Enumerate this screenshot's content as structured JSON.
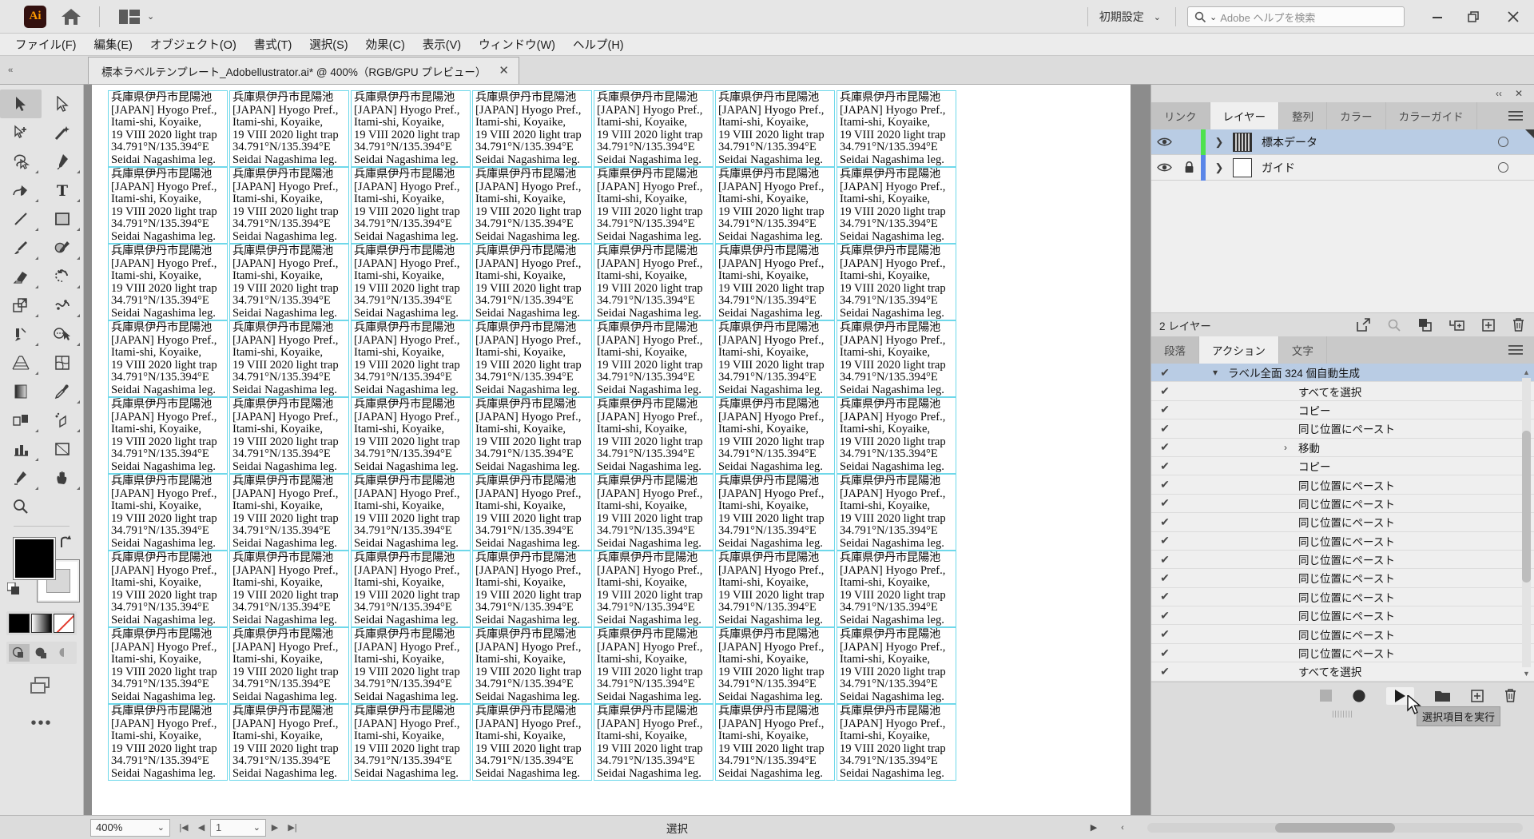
{
  "app": {
    "logo_text": "Ai",
    "preset_label": "初期設定",
    "search_placeholder": "Adobe ヘルプを検索"
  },
  "menubar": {
    "items": [
      {
        "label": "ファイル(F)"
      },
      {
        "label": "編集(E)"
      },
      {
        "label": "オブジェクト(O)"
      },
      {
        "label": "書式(T)"
      },
      {
        "label": "選択(S)"
      },
      {
        "label": "効果(C)"
      },
      {
        "label": "表示(V)"
      },
      {
        "label": "ウィンドウ(W)"
      },
      {
        "label": "ヘルプ(H)"
      }
    ]
  },
  "tabbar": {
    "doc_title": "標本ラベルテンプレート_Adobellustrator.ai* @ 400%（RGB/GPU プレビュー）",
    "close": "✕",
    "collapse": "‹‹"
  },
  "canvas": {
    "label": {
      "line1": "兵庫県伊丹市昆陽池",
      "line2": "[JAPAN] Hyogo Pref.,",
      "line3": "Itami-shi, Koyaike,",
      "line4": "19 VIII 2020 light trap",
      "line5": "34.791°N/135.394°E",
      "line6": "Seidai Nagashima leg."
    },
    "columns": 7,
    "rows": 9
  },
  "dock": {
    "collapse_icon": "‹‹",
    "close_icon": "✕",
    "layers_panel": {
      "tabs": [
        {
          "label": "リンク",
          "active": false
        },
        {
          "label": "レイヤー",
          "active": true
        },
        {
          "label": "整列",
          "active": false
        },
        {
          "label": "カラー",
          "active": false
        },
        {
          "label": "カラーガイド",
          "active": false
        }
      ],
      "rows": [
        {
          "name": "標本データ",
          "color": "#4ee24e",
          "selected": true,
          "locked": false,
          "thumb": "data"
        },
        {
          "name": "ガイド",
          "color": "#5a86e8",
          "selected": false,
          "locked": true,
          "thumb": "blank"
        }
      ],
      "footer_count": "2 レイヤー"
    },
    "actions_panel": {
      "tabs": [
        {
          "label": "段落",
          "active": false
        },
        {
          "label": "アクション",
          "active": true
        },
        {
          "label": "文字",
          "active": false
        }
      ],
      "rows": [
        {
          "label": "ラベル全面 324 個自動生成",
          "selected": true,
          "tree": "▾",
          "indent": 0
        },
        {
          "label": "すべてを選択",
          "selected": false,
          "tree": "",
          "indent": 1
        },
        {
          "label": "コピー",
          "selected": false,
          "tree": "",
          "indent": 1
        },
        {
          "label": "同じ位置にペースト",
          "selected": false,
          "tree": "",
          "indent": 1
        },
        {
          "label": "移動",
          "selected": false,
          "tree": "›",
          "indent": 1
        },
        {
          "label": "コピー",
          "selected": false,
          "tree": "",
          "indent": 1
        },
        {
          "label": "同じ位置にペースト",
          "selected": false,
          "tree": "",
          "indent": 1
        },
        {
          "label": "同じ位置にペースト",
          "selected": false,
          "tree": "",
          "indent": 1
        },
        {
          "label": "同じ位置にペースト",
          "selected": false,
          "tree": "",
          "indent": 1
        },
        {
          "label": "同じ位置にペースト",
          "selected": false,
          "tree": "",
          "indent": 1
        },
        {
          "label": "同じ位置にペースト",
          "selected": false,
          "tree": "",
          "indent": 1
        },
        {
          "label": "同じ位置にペースト",
          "selected": false,
          "tree": "",
          "indent": 1
        },
        {
          "label": "同じ位置にペースト",
          "selected": false,
          "tree": "",
          "indent": 1
        },
        {
          "label": "同じ位置にペースト",
          "selected": false,
          "tree": "",
          "indent": 1
        },
        {
          "label": "同じ位置にペースト",
          "selected": false,
          "tree": "",
          "indent": 1
        },
        {
          "label": "同じ位置にペースト",
          "selected": false,
          "tree": "",
          "indent": 1
        },
        {
          "label": "すべてを選択",
          "selected": false,
          "tree": "",
          "indent": 1
        }
      ],
      "tooltip": "選択項目を実行"
    }
  },
  "statusbar": {
    "zoom": "400%",
    "page": "1",
    "status_text": "選択"
  }
}
